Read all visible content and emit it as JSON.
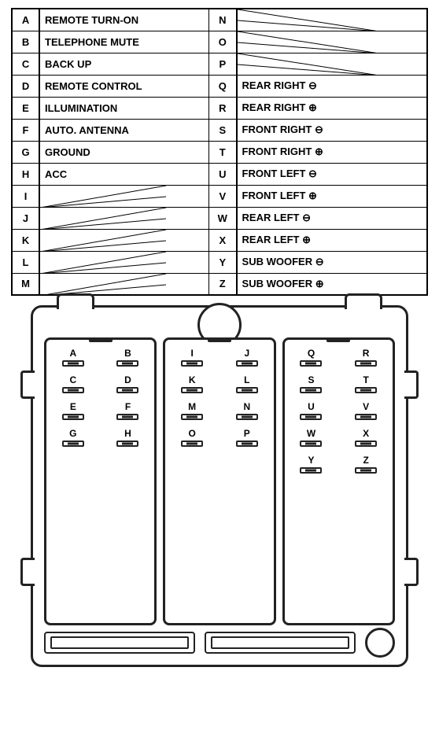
{
  "table": {
    "rows": [
      {
        "left_letter": "A",
        "left_label": "REMOTE TURN-ON",
        "right_letter": "N",
        "right_label": ""
      },
      {
        "left_letter": "B",
        "left_label": "TELEPHONE MUTE",
        "right_letter": "O",
        "right_label": ""
      },
      {
        "left_letter": "C",
        "left_label": "BACK UP",
        "right_letter": "P",
        "right_label": ""
      },
      {
        "left_letter": "D",
        "left_label": "REMOTE CONTROL",
        "right_letter": "Q",
        "right_label": "REAR RIGHT ⊖"
      },
      {
        "left_letter": "E",
        "left_label": "ILLUMINATION",
        "right_letter": "R",
        "right_label": "REAR RIGHT ⊕"
      },
      {
        "left_letter": "F",
        "left_label": "AUTO. ANTENNA",
        "right_letter": "S",
        "right_label": "FRONT RIGHT ⊖"
      },
      {
        "left_letter": "G",
        "left_label": "GROUND",
        "right_letter": "T",
        "right_label": "FRONT RIGHT ⊕"
      },
      {
        "left_letter": "H",
        "left_label": "ACC",
        "right_letter": "U",
        "right_label": "FRONT LEFT ⊖"
      },
      {
        "left_letter": "I",
        "left_label": "",
        "right_letter": "V",
        "right_label": "FRONT LEFT ⊕"
      },
      {
        "left_letter": "J",
        "left_label": "",
        "right_letter": "W",
        "right_label": "REAR LEFT ⊖"
      },
      {
        "left_letter": "K",
        "left_label": "",
        "right_letter": "X",
        "right_label": "REAR LEFT ⊕"
      },
      {
        "left_letter": "L",
        "left_label": "",
        "right_letter": "Y",
        "right_label": "SUB WOOFER ⊖"
      },
      {
        "left_letter": "M",
        "left_label": "",
        "right_letter": "Z",
        "right_label": "SUB WOOFER ⊕"
      }
    ]
  },
  "connector": {
    "left_section": {
      "pins": [
        "A",
        "B",
        "C",
        "D",
        "E",
        "F",
        "G",
        "H"
      ]
    },
    "middle_section": {
      "pins": [
        "I",
        "J",
        "K",
        "L",
        "M",
        "N",
        "O",
        "P"
      ]
    },
    "right_section": {
      "pins": [
        "Q",
        "R",
        "S",
        "T",
        "U",
        "V",
        "W",
        "X",
        "Y",
        "Z"
      ]
    }
  }
}
